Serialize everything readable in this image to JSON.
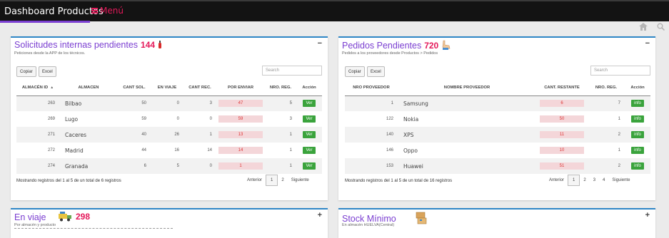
{
  "header": {
    "brand": "Dashboard Productos",
    "menu_label": "Menú"
  },
  "left_panel": {
    "title": "Solicitudes internas pendientes",
    "count": "144",
    "subtitle": "Peticiones desde la APP de los técnicos.",
    "toggle": "−",
    "buttons": {
      "copy": "Copiar",
      "excel": "Excel"
    },
    "search_placeholder": "Search",
    "columns": [
      "ALMACÉN ID",
      "ALMACEN",
      "CANT SOL.",
      "EN VIAJE",
      "CANT REC.",
      "POR ENVIAR",
      "NRO. REG.",
      "Acción"
    ],
    "rows": [
      {
        "id": "263",
        "almacen": "Bilbao",
        "cant_sol": "50",
        "en_viaje": "0",
        "cant_rec": "3",
        "por_enviar": "47",
        "nro_reg": "5",
        "accion": "Ver"
      },
      {
        "id": "269",
        "almacen": "Lugo",
        "cant_sol": "59",
        "en_viaje": "0",
        "cant_rec": "0",
        "por_enviar": "59",
        "nro_reg": "3",
        "accion": "Ver"
      },
      {
        "id": "271",
        "almacen": "Caceres",
        "cant_sol": "40",
        "en_viaje": "26",
        "cant_rec": "1",
        "por_enviar": "13",
        "nro_reg": "1",
        "accion": "Ver"
      },
      {
        "id": "272",
        "almacen": "Madrid",
        "cant_sol": "44",
        "en_viaje": "16",
        "cant_rec": "14",
        "por_enviar": "14",
        "nro_reg": "1",
        "accion": "Ver"
      },
      {
        "id": "274",
        "almacen": "Granada",
        "cant_sol": "6",
        "en_viaje": "5",
        "cant_rec": "0",
        "por_enviar": "1",
        "nro_reg": "1",
        "accion": "Ver"
      }
    ],
    "info": "Mostrando registros del 1 al 5 de un total de 6 registros",
    "pager": {
      "prev": "Anterior",
      "pages": [
        "1",
        "2"
      ],
      "next": "Siguiente"
    }
  },
  "right_panel": {
    "title": "Pedidos Pendientes",
    "count": "720",
    "subtitle": "Pedidos a los proveedores desde Productos > Pedidos",
    "toggle": "−",
    "buttons": {
      "copy": "Copiar",
      "excel": "Excel"
    },
    "search_placeholder": "Search",
    "columns": [
      "NRO PROVEEDOR",
      "NOMBRE PROVEEDOR",
      "CANT. RESTANTE",
      "NRO. REG.",
      "Acción"
    ],
    "rows": [
      {
        "nro": "1",
        "nombre": "Samsung",
        "restante": "6",
        "nro_reg": "7",
        "accion": "info"
      },
      {
        "nro": "122",
        "nombre": "Nokia",
        "restante": "50",
        "nro_reg": "1",
        "accion": "info"
      },
      {
        "nro": "140",
        "nombre": "XPS",
        "restante": "11",
        "nro_reg": "2",
        "accion": "info"
      },
      {
        "nro": "146",
        "nombre": "Oppo",
        "restante": "10",
        "nro_reg": "1",
        "accion": "info"
      },
      {
        "nro": "153",
        "nombre": "Huawei",
        "restante": "51",
        "nro_reg": "2",
        "accion": "info"
      }
    ],
    "info": "Mostrando registros del 1 al 5 de un total de 16 registros",
    "pager": {
      "prev": "Anterior",
      "pages": [
        "1",
        "2",
        "3",
        "4"
      ],
      "next": "Siguiente"
    }
  },
  "bottom_left": {
    "title": "En viaje",
    "count": "298",
    "subtitle": "Por almacén y producto",
    "toggle": "+"
  },
  "bottom_right": {
    "title": "Stock Mínimo",
    "subtitle": "En almacén HUELVA(Central)",
    "toggle": "+"
  },
  "icons": {
    "home": "home-icon",
    "search": "search-icon"
  },
  "colors": {
    "accent": "#7b3fd1",
    "count": "#e4195a",
    "panel_border": "#2f86c6",
    "action_green": "#3aa33c",
    "pill_bg": "#f4d6d9"
  }
}
